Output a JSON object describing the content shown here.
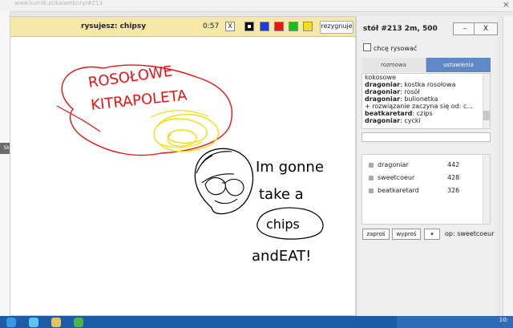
{
  "drawing": {
    "label": "rysujesz: chipsy",
    "timer": "0:57",
    "quit_label": "rezygnuje",
    "clear_label": "X",
    "colors": [
      "#000000",
      "#1e3bdc",
      "#ef1313",
      "#13c313",
      "#f5e113"
    ]
  },
  "panel": {
    "table_label": "stół #213   2m, 500",
    "minimize_label": "–",
    "close_label": "X",
    "want_draw_label": "chcę rysować",
    "tabs": [
      {
        "label": "rozmowa"
      },
      {
        "label": "ustawienia"
      }
    ],
    "chat": [
      {
        "user": "",
        "text": "kokosowe"
      },
      {
        "user": "dragoniar",
        "text": "kostka rosołowa"
      },
      {
        "user": "dragoniar",
        "text": "rosół"
      },
      {
        "user": "dragoniar",
        "text": "bulionetka"
      },
      {
        "user": "",
        "text": "+ rozwiązanie zaczyna się od: c..."
      },
      {
        "user": "beatkaretard",
        "text": "czips"
      },
      {
        "user": "dragoniar",
        "text": "cycki"
      }
    ],
    "players": [
      {
        "name": "dragoniar",
        "score": "442"
      },
      {
        "name": "sweetcoeur",
        "score": "428"
      },
      {
        "name": "beatkaretard",
        "score": "326"
      }
    ],
    "invite_label": "zaproś",
    "kick_label": "wyproś",
    "op_label": "op: sweetcoeur"
  },
  "browser": {
    "url": "www.kurnik.pl/kalambury/#213",
    "side_tab": "Skrót001..."
  },
  "canvas_text": {
    "rosolowe": "ROSOŁOWE",
    "kitrapoleta": "KITRAPOLETA",
    "line1": "Im gonne",
    "line2": "take a",
    "line3": "chips",
    "line4": "andEAT!"
  },
  "taskbar": {
    "clock": "10:"
  }
}
